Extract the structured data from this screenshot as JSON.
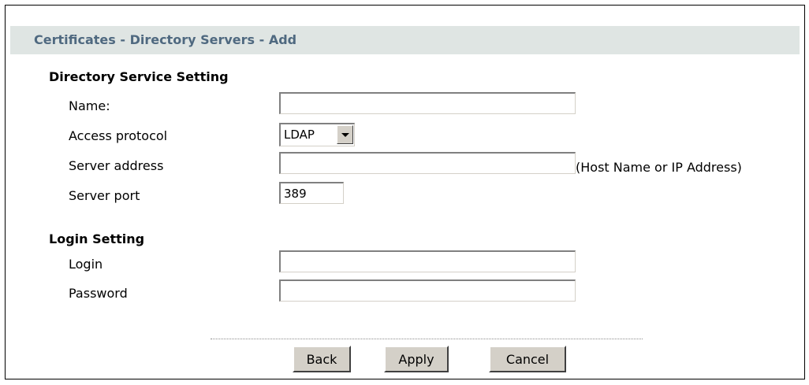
{
  "header": {
    "title": "Certificates - Directory Servers - Add"
  },
  "directory_service": {
    "section_title": "Directory Service Setting",
    "name_label": "Name:",
    "name_value": "",
    "protocol_label": "Access protocol",
    "protocol_value": "LDAP",
    "address_label": "Server address",
    "address_value": "",
    "address_hint": "(Host Name or IP Address)",
    "port_label": "Server port",
    "port_value": "389"
  },
  "login_setting": {
    "section_title": "Login Setting",
    "login_label": "Login",
    "login_value": "",
    "password_label": "Password",
    "password_value": ""
  },
  "actions": {
    "back_label": "Back",
    "apply_label": "Apply",
    "cancel_label": "Cancel"
  },
  "colors": {
    "title_bar": "#dfe5e3",
    "title_text": "#4f6980",
    "button_face": "#d4d0c8"
  }
}
